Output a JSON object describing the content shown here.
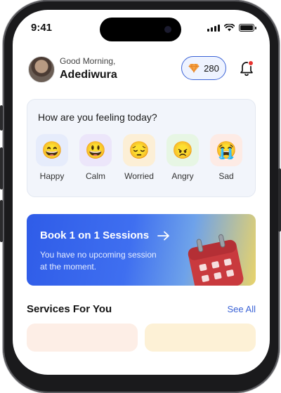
{
  "status_bar": {
    "time": "9:41"
  },
  "header": {
    "greeting": "Good Morning,",
    "username": "Adediwura",
    "points": "280"
  },
  "mood_check": {
    "question": "How are you feeling today?",
    "moods": [
      {
        "label": "Happy",
        "emoji": "😄",
        "bg": "#e6ecfb"
      },
      {
        "label": "Calm",
        "emoji": "😃",
        "bg": "#ece6fa"
      },
      {
        "label": "Worried",
        "emoji": "😔",
        "bg": "#fcefd6"
      },
      {
        "label": "Angry",
        "emoji": "😠",
        "bg": "#e7f6e4"
      },
      {
        "label": "Sad",
        "emoji": "😭",
        "bg": "#fdebe5"
      }
    ]
  },
  "session_card": {
    "title": "Book 1 on 1 Sessions",
    "description": "You have no upcoming session at the moment.",
    "arrow_icon": "arrow-right-icon"
  },
  "services": {
    "title": "Services For You",
    "see_all": "See All"
  },
  "colors": {
    "accent": "#3b63d6",
    "card_bg": "#f2f5fb"
  }
}
